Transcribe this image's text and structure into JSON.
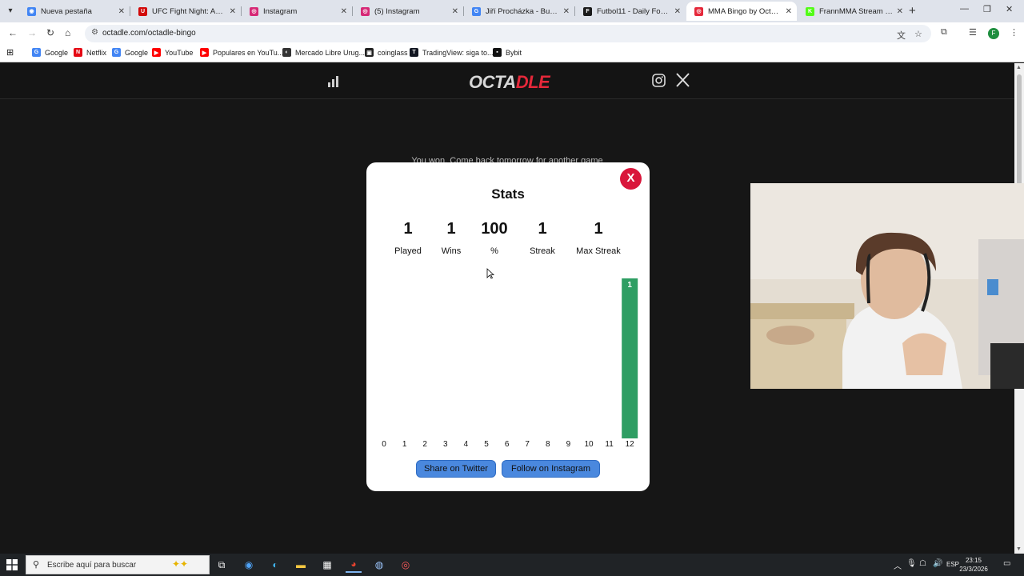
{
  "browser": {
    "tabs": [
      {
        "title": "Nueva pestaña",
        "active": false,
        "favicon": "chrome-icon"
      },
      {
        "title": "UFC Fight Night: Adesanya",
        "active": false,
        "favicon": "ufc-icon"
      },
      {
        "title": "Instagram",
        "active": false,
        "favicon": "instagram-icon"
      },
      {
        "title": "(5) Instagram",
        "active": false,
        "favicon": "instagram-icon"
      },
      {
        "title": "Jiří Procházka - Buscar co",
        "active": false,
        "favicon": "google-icon"
      },
      {
        "title": "Futbol11 - Daily Football",
        "active": false,
        "favicon": "futbol11-icon"
      },
      {
        "title": "MMA Bingo by Octadle -",
        "active": true,
        "favicon": "octadle-icon"
      },
      {
        "title": "FrannMMA Stream - Wat",
        "active": false,
        "favicon": "kick-icon"
      }
    ],
    "url": "octadle.com/octadle-bingo",
    "bookmarks": [
      {
        "label": "Google",
        "icon": "google-icon"
      },
      {
        "label": "Netflix",
        "icon": "netflix-icon"
      },
      {
        "label": "Google",
        "icon": "google-icon"
      },
      {
        "label": "YouTube",
        "icon": "youtube-icon"
      },
      {
        "label": "Populares en YouTu...",
        "icon": "youtube-icon"
      },
      {
        "label": "Mercado Libre Urug...",
        "icon": "mercadolibre-icon"
      },
      {
        "label": "coinglass",
        "icon": "coinglass-icon"
      },
      {
        "label": "TradingView: siga to...",
        "icon": "tradingview-icon"
      },
      {
        "label": "Bybit",
        "icon": "bybit-icon"
      }
    ],
    "profile_initial": "F"
  },
  "site": {
    "logo_part1": "OCTA",
    "logo_part2": "DLE",
    "background_message": "You won. Come back tomorrow for another game"
  },
  "modal": {
    "close_label": "X",
    "title": "Stats",
    "stats": [
      {
        "value": "1",
        "label": "Played"
      },
      {
        "value": "1",
        "label": "Wins"
      },
      {
        "value": "100",
        "label": "%"
      },
      {
        "value": "1",
        "label": "Streak"
      },
      {
        "value": "1",
        "label": "Max Streak"
      }
    ],
    "share_label": "Share on Twitter",
    "follow_label": "Follow on Instagram"
  },
  "chart_data": {
    "type": "bar",
    "categories": [
      "0",
      "1",
      "2",
      "3",
      "4",
      "5",
      "6",
      "7",
      "8",
      "9",
      "10",
      "11",
      "12"
    ],
    "values": [
      0,
      0,
      0,
      0,
      0,
      0,
      0,
      0,
      0,
      0,
      0,
      0,
      1
    ],
    "bar_color": "#2e9e63"
  },
  "taskbar": {
    "search_placeholder": "Escribe aquí para buscar",
    "language": "ESP",
    "time": "23:15",
    "date": "23/3/2026"
  }
}
